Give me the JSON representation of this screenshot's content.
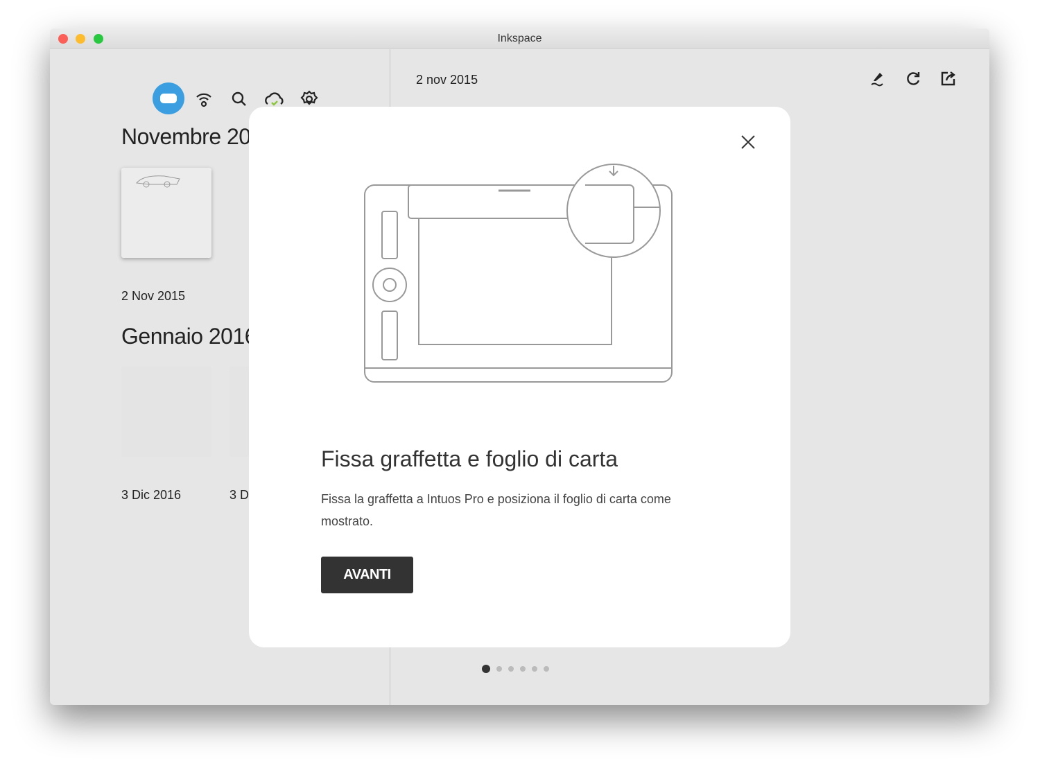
{
  "window": {
    "title": "Inkspace"
  },
  "sidebar": {
    "toolbar": [
      "device-icon",
      "wifi-icon",
      "search-icon",
      "cloud-sync-icon",
      "gear-icon"
    ],
    "sections": [
      {
        "heading": "Novembre 2015",
        "items": [
          {
            "date": "2 Nov 2015"
          }
        ]
      },
      {
        "heading": "Gennaio 2016",
        "items": [
          {
            "date": "3 Dic 2016"
          },
          {
            "date": "3 Dic 2016"
          }
        ]
      }
    ]
  },
  "main": {
    "date": "2 nov 2015",
    "toolbar": [
      "pen-icon",
      "redo-icon",
      "share-icon"
    ]
  },
  "modal": {
    "title": "Fissa graffetta e foglio di carta",
    "description": "Fissa la graffetta a Intuos Pro e posiziona il foglio di carta come mostrato.",
    "button": "AVANTI",
    "pagination": {
      "current": 1,
      "total": 6
    }
  },
  "colors": {
    "accent": "#3a9ee0",
    "check": "#8cc63f"
  }
}
